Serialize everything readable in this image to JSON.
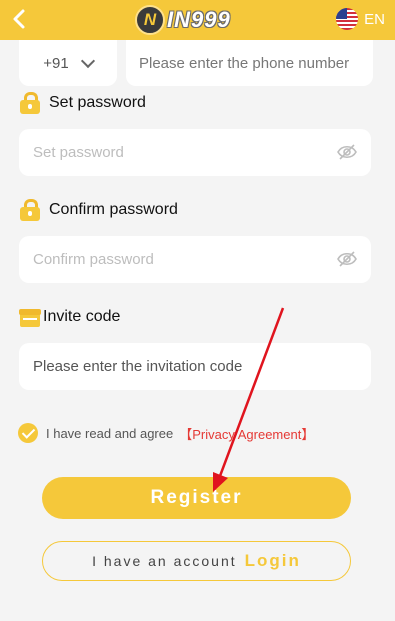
{
  "header": {
    "back_icon": "chevron-left-icon",
    "logo_mark": "N",
    "logo_text": "IN999",
    "language_flag": "us-flag-icon",
    "language": "EN"
  },
  "phone": {
    "country_code": "+91",
    "placeholder": "Please enter the phone number"
  },
  "set_password": {
    "label": "Set password",
    "placeholder": "Set password"
  },
  "confirm_password": {
    "label": "Confirm password",
    "placeholder": "Confirm password"
  },
  "invite": {
    "label": "Invite code",
    "placeholder": "Please enter the invitation code"
  },
  "agreement": {
    "text": "I have read and agree",
    "link": "【Privacy Agreement】",
    "checked": true
  },
  "actions": {
    "register": "Register",
    "have_account": "I have an account",
    "login": "Login"
  },
  "colors": {
    "accent": "#f5c83a",
    "link": "#e53935",
    "annotation_arrow": "#e0141e"
  }
}
